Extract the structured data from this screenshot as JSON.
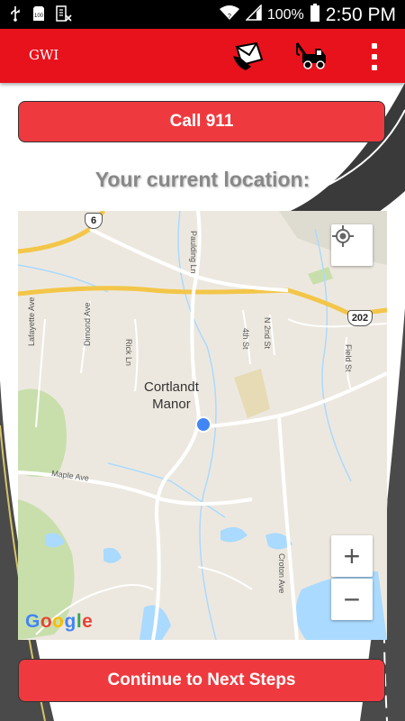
{
  "status_bar": {
    "battery_percent": "100%",
    "time": "2:50 PM",
    "left_icons": [
      "usb-icon",
      "sd-card-icon",
      "no-sim-icon"
    ],
    "right_icons": [
      "wifi-icon",
      "signal-icon",
      "battery-icon"
    ]
  },
  "app_bar": {
    "title": "GWI",
    "actions": [
      "envelope-hand-icon",
      "tow-truck-icon",
      "overflow-menu-icon"
    ]
  },
  "buttons": {
    "call": "Call 911",
    "continue": "Continue to Next Steps"
  },
  "location_label": "Your current location:",
  "map": {
    "town_line1": "Cortlandt",
    "town_line2": "Manor",
    "shield_6": "6",
    "shield_202": "202",
    "roads": {
      "paulding": "Paulding Ln",
      "lafayette": "Lafayette Ave",
      "dimond": "Dimond Ave",
      "rick": "Rick Ln",
      "n2nd": "N 2nd St",
      "fourth": "4th St",
      "field": "Field St",
      "maple": "Maple Ave",
      "croton": "Croton Ave"
    },
    "logo": "Google",
    "controls": {
      "zoom_in": "+",
      "zoom_out": "−"
    },
    "colors": {
      "land": "#ede8df",
      "water": "#aadaff",
      "park": "#c8dfac",
      "highway": "#f8d66b",
      "location_dot": "#4285f4"
    }
  },
  "colors": {
    "accent": "#e8121c",
    "button": "#ee3a3f"
  }
}
